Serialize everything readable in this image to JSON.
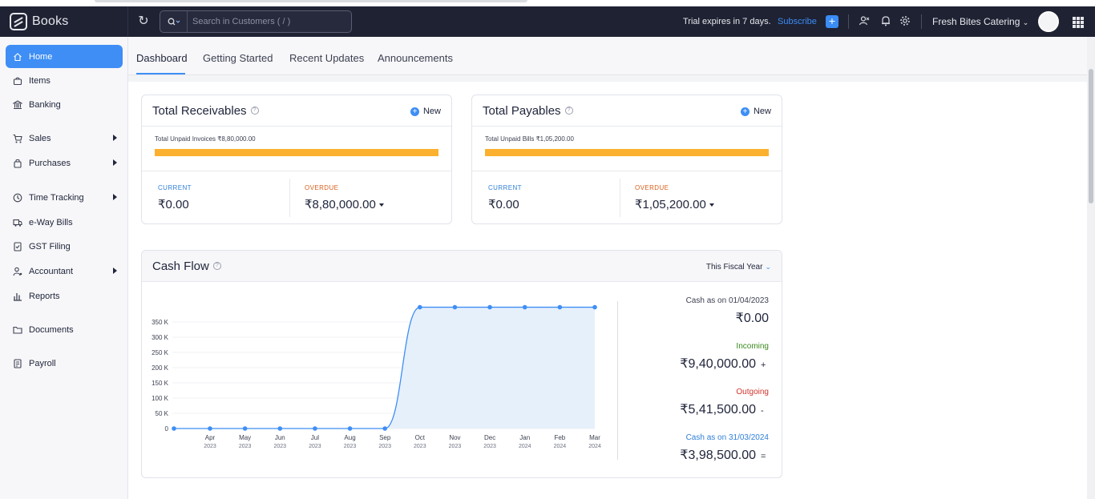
{
  "header": {
    "app_title": "Books",
    "search_placeholder": "Search in Customers ( / )",
    "trial_text": "Trial expires in 7 days.",
    "subscribe_label": "Subscribe",
    "org_name": "Fresh Bites Catering"
  },
  "sidebar": {
    "items": [
      {
        "label": "Home",
        "icon": "home-icon",
        "active": true
      },
      {
        "label": "Items",
        "icon": "basket-icon"
      },
      {
        "label": "Banking",
        "icon": "bank-icon"
      },
      {
        "label": "Sales",
        "icon": "cart-icon",
        "has_submenu": true
      },
      {
        "label": "Purchases",
        "icon": "bag-icon",
        "has_submenu": true
      },
      {
        "label": "Time Tracking",
        "icon": "clock-icon",
        "has_submenu": true
      },
      {
        "label": "e-Way Bills",
        "icon": "truck-icon"
      },
      {
        "label": "GST Filing",
        "icon": "document-check-icon"
      },
      {
        "label": "Accountant",
        "icon": "person-icon",
        "has_submenu": true
      },
      {
        "label": "Reports",
        "icon": "bar-chart-icon"
      },
      {
        "label": "Documents",
        "icon": "folder-icon"
      },
      {
        "label": "Payroll",
        "icon": "payroll-icon"
      }
    ]
  },
  "tabs": [
    "Dashboard",
    "Getting Started",
    "Recent Updates",
    "Announcements"
  ],
  "receivables": {
    "title": "Total Receivables",
    "new_label": "New",
    "unpaid_text": "Total Unpaid Invoices ₹8,80,000.00",
    "current_label": "CURRENT",
    "current_value": "₹0.00",
    "overdue_label": "OVERDUE",
    "overdue_value": "₹8,80,000.00"
  },
  "payables": {
    "title": "Total Payables",
    "new_label": "New",
    "unpaid_text": "Total Unpaid Bills ₹1,05,200.00",
    "current_label": "CURRENT",
    "current_value": "₹0.00",
    "overdue_label": "OVERDUE",
    "overdue_value": "₹1,05,200.00"
  },
  "cashflow": {
    "title": "Cash Flow",
    "period_label": "This Fiscal Year",
    "stats": [
      {
        "label": "Cash as on 01/04/2023",
        "value": "₹0.00",
        "op": "",
        "color": "#3d4152"
      },
      {
        "label": "Incoming",
        "value": "₹9,40,000.00",
        "op": "+",
        "color": "#3a8a1f"
      },
      {
        "label": "Outgoing",
        "value": "₹5,41,500.00",
        "op": "-",
        "color": "#d0342c"
      },
      {
        "label": "Cash as on 31/03/2024",
        "value": "₹3,98,500.00",
        "op": "=",
        "color": "#2f7fd8"
      }
    ]
  },
  "chart_data": {
    "type": "area",
    "x": [
      "Apr 2023",
      "May 2023",
      "Jun 2023",
      "Jul 2023",
      "Aug 2023",
      "Sep 2023",
      "Oct 2023",
      "Nov 2023",
      "Dec 2023",
      "Jan 2024",
      "Feb 2024",
      "Mar 2024"
    ],
    "x_months": [
      "Apr",
      "May",
      "Jun",
      "Jul",
      "Aug",
      "Sep",
      "Oct",
      "Nov",
      "Dec",
      "Jan",
      "Feb",
      "Mar"
    ],
    "x_years": [
      "2023",
      "2023",
      "2023",
      "2023",
      "2023",
      "2023",
      "2023",
      "2023",
      "2023",
      "2024",
      "2024",
      "2024"
    ],
    "start_value": 0,
    "values": [
      0,
      0,
      0,
      0,
      0,
      0,
      398500,
      398500,
      398500,
      398500,
      398500,
      398500
    ],
    "yticks": [
      0,
      50000,
      100000,
      150000,
      200000,
      250000,
      300000,
      350000
    ],
    "ytick_labels": [
      "0",
      "50 K",
      "100 K",
      "150 K",
      "200 K",
      "250 K",
      "300 K",
      "350 K"
    ],
    "ylim": [
      0,
      400000
    ],
    "line_color": "#3e8ef5",
    "fill_color": "#e6f0fb"
  }
}
